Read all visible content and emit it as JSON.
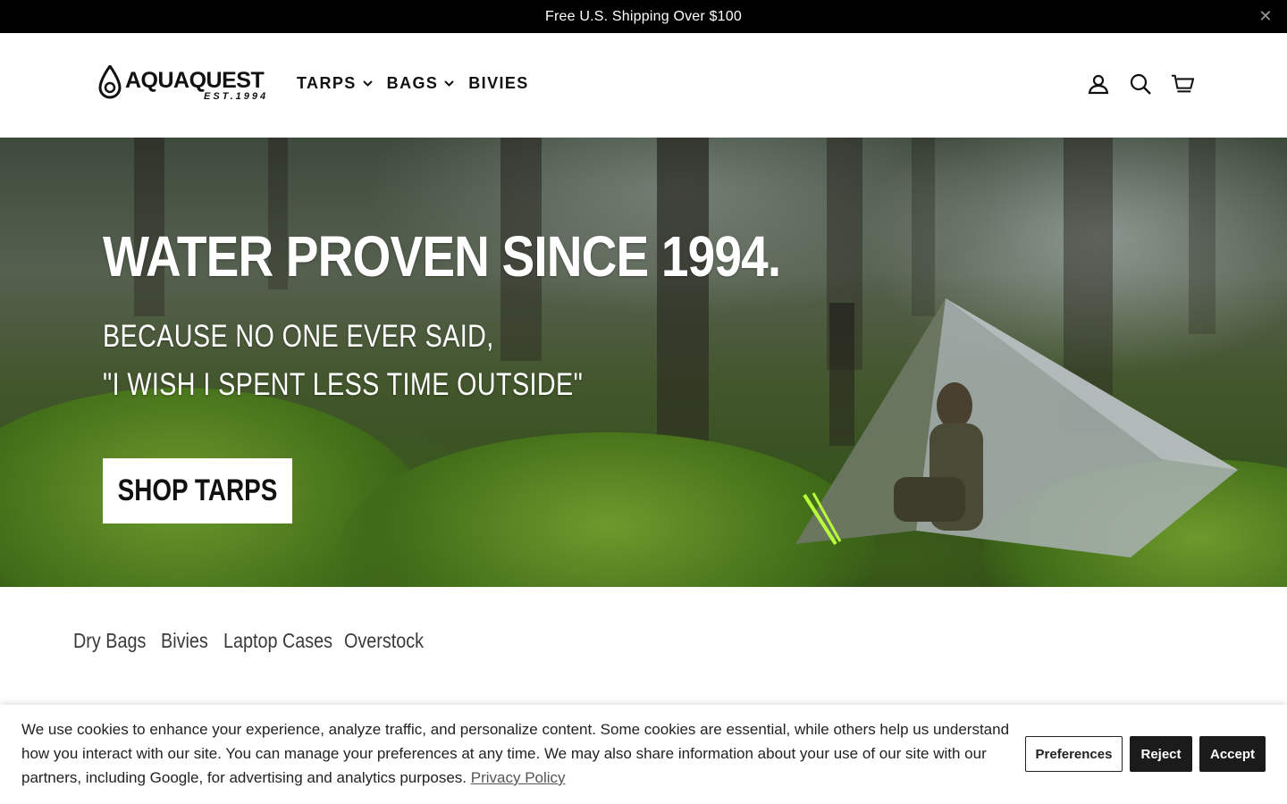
{
  "announcement": {
    "text": "Free U.S. Shipping Over $100",
    "close_icon": "close-icon"
  },
  "header": {
    "logo": {
      "word": "AQUAQUEST",
      "est": "EST.1994"
    },
    "nav": [
      {
        "label": "TARPS",
        "has_dropdown": true
      },
      {
        "label": "BAGS",
        "has_dropdown": true
      },
      {
        "label": "BIVIES",
        "has_dropdown": false
      }
    ],
    "icons": [
      "account-icon",
      "search-icon",
      "cart-icon"
    ]
  },
  "hero": {
    "title": "WATER PROVEN SINCE 1994.",
    "subtitle_line1": "BECAUSE NO ONE EVER SAID,",
    "subtitle_line2": "\"I WISH I SPENT LESS TIME OUTSIDE\"",
    "button_label": "SHOP TARPS"
  },
  "collections": [
    "Dry Bags",
    "Bivies",
    "Laptop Cases",
    "Overstock"
  ],
  "cookie": {
    "text": "We use cookies to enhance your experience, analyze traffic, and personalize content. Some cookies are essential, while others help us understand how you interact with our site. You can manage your preferences at any time. We may also share information about your use of our site with our partners, including Google, for advertising and analytics purposes.",
    "link": "Privacy Policy",
    "preferences": "Preferences",
    "reject": "Reject",
    "accept": "Accept"
  },
  "colors": {
    "announcement_bg": "#000000",
    "button_dark": "#1b1b1b",
    "hero_text": "#ffffff"
  }
}
